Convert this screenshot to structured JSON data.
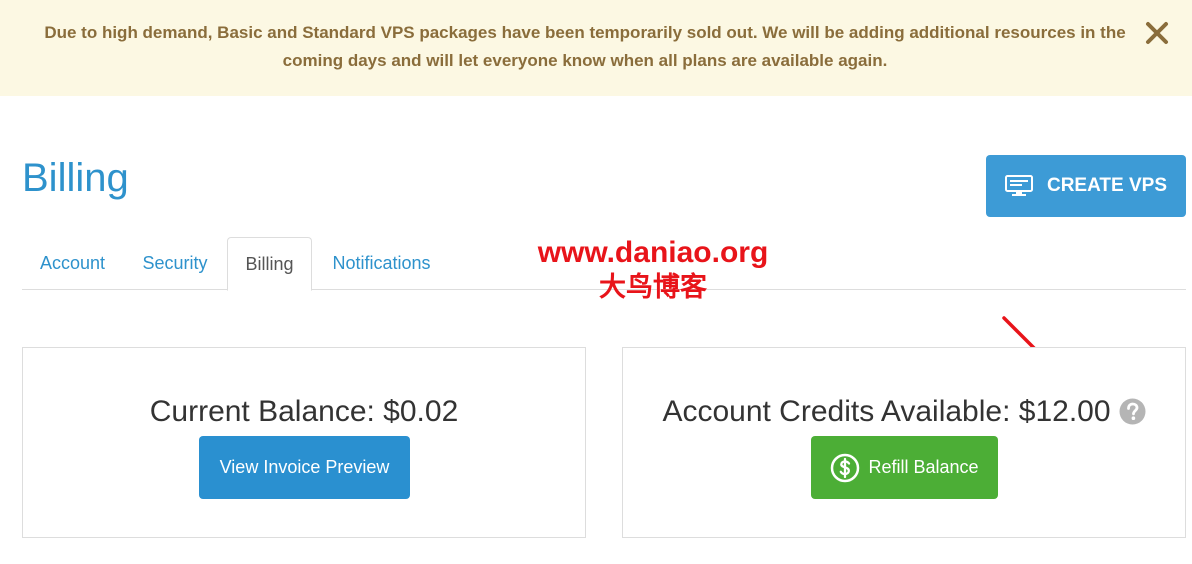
{
  "notice": {
    "text": "Due to high demand, Basic and Standard VPS packages have been temporarily sold out. We will be adding additional resources in the coming days and will let everyone know when all plans are available again.",
    "close_icon": "close-icon"
  },
  "header": {
    "title": "Billing",
    "create_vps_label": "CREATE VPS",
    "create_vps_icon": "monitor-icon"
  },
  "tabs": [
    {
      "label": "Account",
      "active": false
    },
    {
      "label": "Security",
      "active": false
    },
    {
      "label": "Billing",
      "active": true
    },
    {
      "label": "Notifications",
      "active": false
    }
  ],
  "watermark": {
    "url": "www.daniao.org",
    "cn": "大鸟博客"
  },
  "balance_panel": {
    "label": "Current Balance: $0.02",
    "button_label": "View Invoice Preview"
  },
  "credits_panel": {
    "label": "Account Credits Available: $12.00",
    "help_icon": "question-circle-icon",
    "button_label": "Refill Balance",
    "button_icon": "dollar-circle-icon"
  },
  "colors": {
    "link_blue": "#2e92cc",
    "primary_button": "#2a90d0",
    "success_button": "#4cae36",
    "warning_bg": "#fcf8e3",
    "warning_text": "#8a6d3b",
    "annotation_red": "#e8141a"
  }
}
